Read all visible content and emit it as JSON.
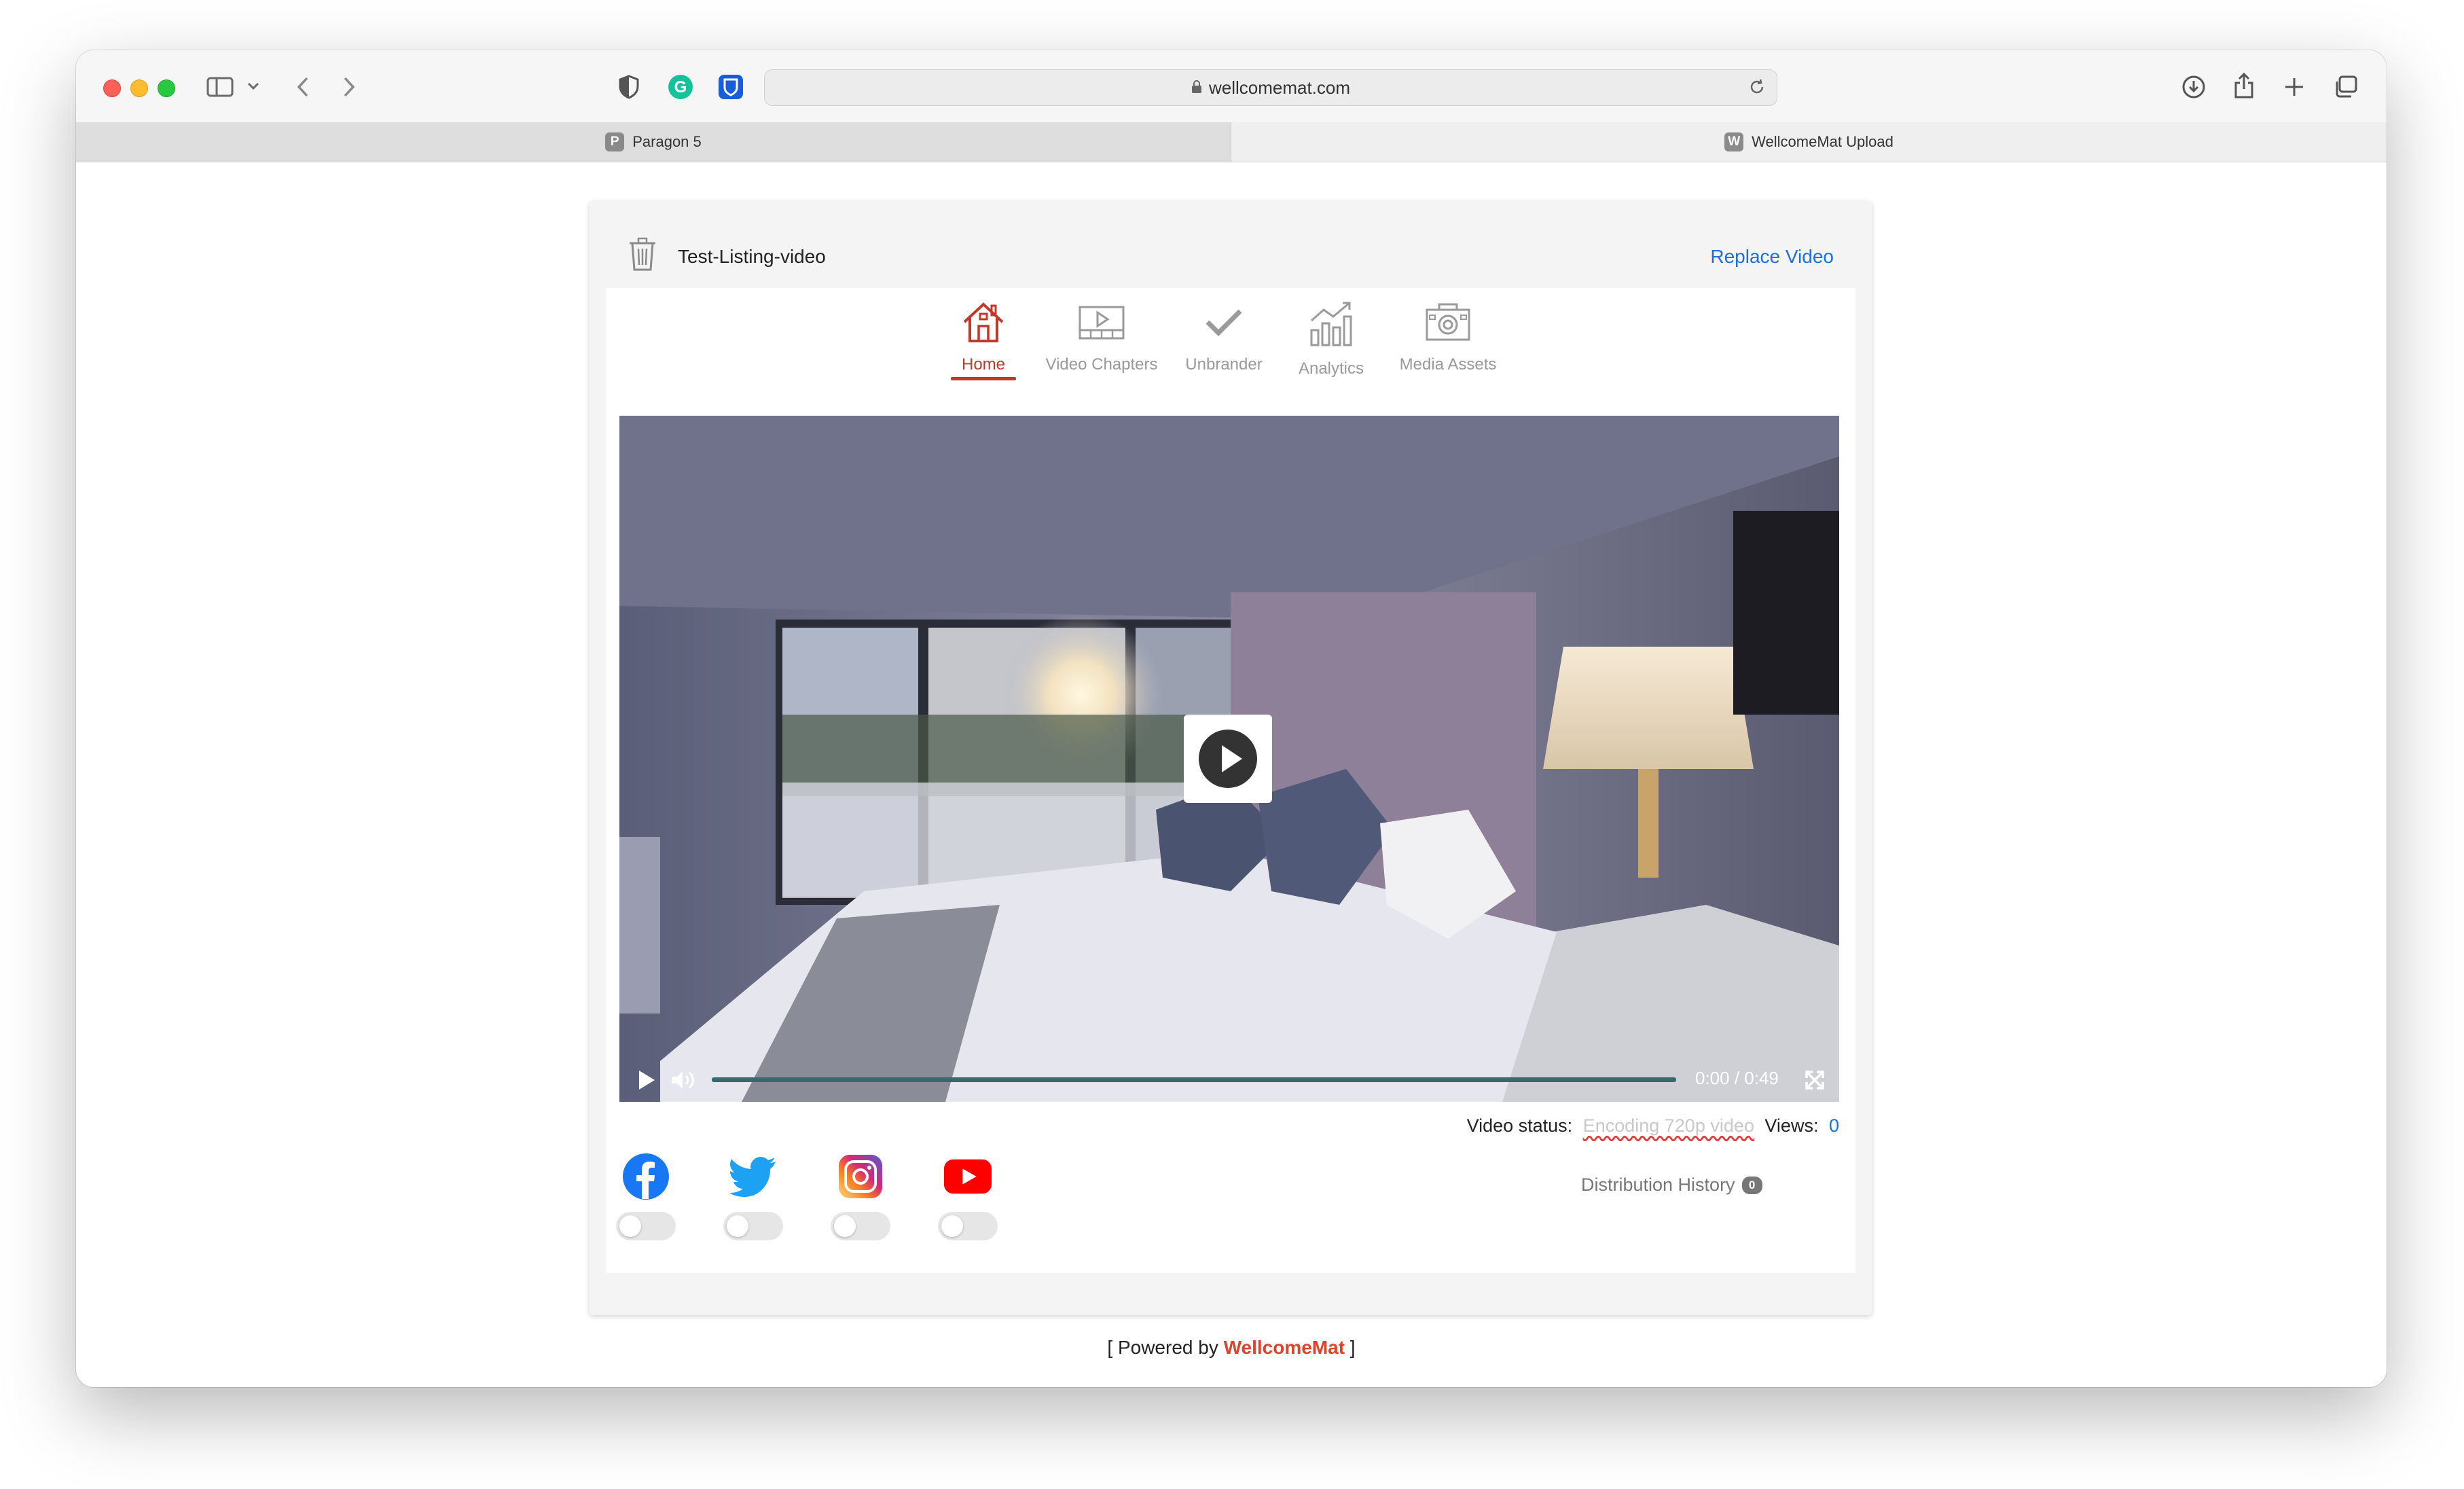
{
  "browser": {
    "url": "wellcomemat.com",
    "tabs": [
      {
        "label": "Paragon 5",
        "favicon": "P"
      },
      {
        "label": "WellcomeMat Upload",
        "favicon": "W"
      }
    ]
  },
  "video": {
    "title": "Test-Listing-video",
    "replace_label": "Replace Video",
    "timecode": "0:00 / 0:49"
  },
  "nav": {
    "items": [
      {
        "label": "Home",
        "icon": "house-icon",
        "active": true
      },
      {
        "label": "Video Chapters",
        "icon": "film-icon"
      },
      {
        "label": "Unbrander",
        "icon": "checkmark-icon"
      },
      {
        "label": "Analytics",
        "icon": "bar-chart-icon"
      },
      {
        "label": "Media Assets",
        "icon": "camera-icon"
      }
    ]
  },
  "status": {
    "label": "Video status:",
    "value": "Encoding 720p video",
    "views_label": "Views:",
    "views_value": "0"
  },
  "distribution": {
    "label": "Distribution History",
    "count": "0"
  },
  "social": [
    {
      "name": "facebook",
      "icon": "facebook-icon",
      "color": "#1877f2"
    },
    {
      "name": "twitter",
      "icon": "twitter-icon",
      "color": "#1da1f2"
    },
    {
      "name": "instagram",
      "icon": "instagram-icon",
      "color": "#c13584"
    },
    {
      "name": "youtube",
      "icon": "youtube-icon",
      "color": "#ff0000"
    }
  ],
  "footer": {
    "prefix": "[ Powered by ",
    "brand": "WellcomeMat",
    "suffix": " ]"
  }
}
